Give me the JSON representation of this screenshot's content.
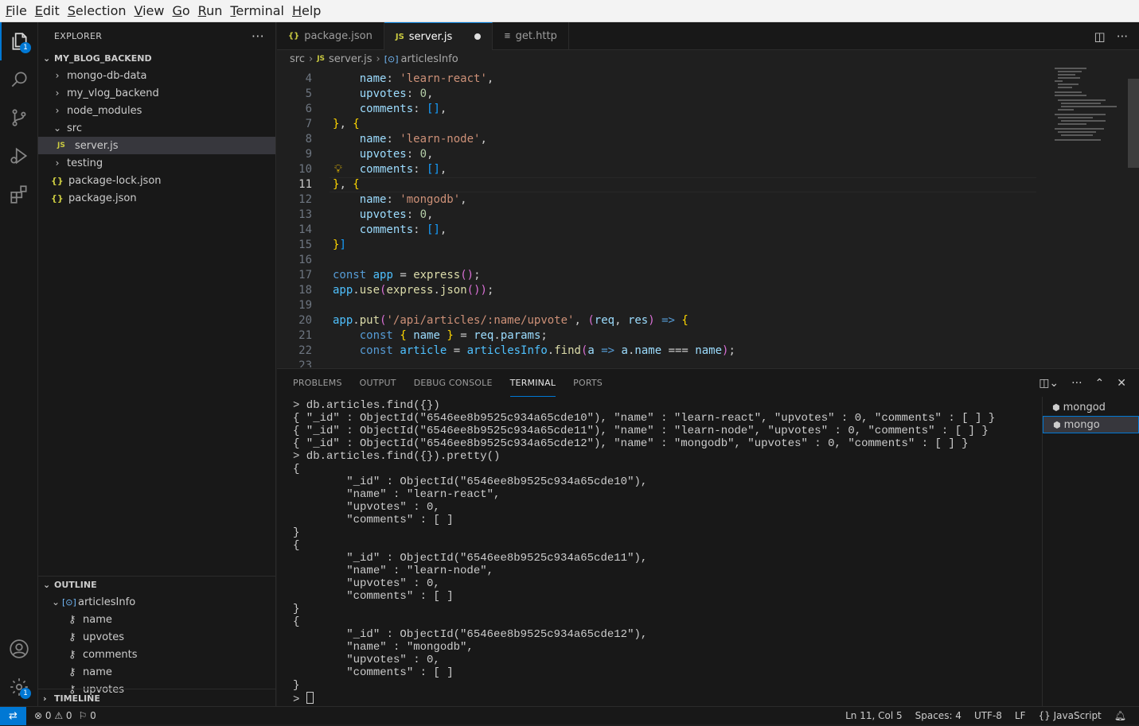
{
  "menu": [
    "File",
    "Edit",
    "Selection",
    "View",
    "Go",
    "Run",
    "Terminal",
    "Help"
  ],
  "menu_mnemonics": [
    "F",
    "E",
    "S",
    "V",
    "G",
    "R",
    "T",
    "H"
  ],
  "activity": {
    "explorer_badge": "1",
    "settings_badge": "1"
  },
  "sidebar": {
    "title": "EXPLORER",
    "project": "MY_BLOG_BACKEND",
    "tree": [
      {
        "label": "mongo-db-data",
        "type": "folder"
      },
      {
        "label": "my_vlog_backend",
        "type": "folder"
      },
      {
        "label": "node_modules",
        "type": "folder"
      },
      {
        "label": "src",
        "type": "folder-open"
      },
      {
        "label": "server.js",
        "type": "js"
      },
      {
        "label": "testing",
        "type": "folder"
      },
      {
        "label": "package-lock.json",
        "type": "json"
      },
      {
        "label": "package.json",
        "type": "json"
      }
    ],
    "outline_title": "OUTLINE",
    "outline": [
      {
        "label": "articlesInfo",
        "kind": "variable"
      },
      {
        "label": "name",
        "kind": "key"
      },
      {
        "label": "upvotes",
        "kind": "key"
      },
      {
        "label": "comments",
        "kind": "key"
      },
      {
        "label": "name",
        "kind": "key"
      },
      {
        "label": "upvotes",
        "kind": "key"
      }
    ],
    "timeline_title": "TIMELINE"
  },
  "tabs": [
    {
      "label": "package.json",
      "icon": "{}"
    },
    {
      "label": "server.js",
      "icon": "JS",
      "active": true,
      "dirty": true
    },
    {
      "label": "get.http",
      "icon": "≡"
    }
  ],
  "breadcrumb": [
    "src",
    "server.js",
    "articlesInfo"
  ],
  "breadcrumb_icons": {
    "js": "JS",
    "symbol": "[⊙]"
  },
  "editor": {
    "current_line": "11",
    "lines": [
      {
        "n": "4",
        "text": "    name: 'learn-react',"
      },
      {
        "n": "5",
        "text": "    upvotes: 0,"
      },
      {
        "n": "6",
        "text": "    comments: [],"
      },
      {
        "n": "7",
        "text": "}, {"
      },
      {
        "n": "8",
        "text": "    name: 'learn-node',"
      },
      {
        "n": "9",
        "text": "    upvotes: 0,"
      },
      {
        "n": "10",
        "text": "    comments: [],"
      },
      {
        "n": "11",
        "text": "}, {"
      },
      {
        "n": "12",
        "text": "    name: 'mongodb',"
      },
      {
        "n": "13",
        "text": "    upvotes: 0,"
      },
      {
        "n": "14",
        "text": "    comments: [],"
      },
      {
        "n": "15",
        "text": "}]"
      },
      {
        "n": "16",
        "text": ""
      },
      {
        "n": "17",
        "text": "const app = express();"
      },
      {
        "n": "18",
        "text": "app.use(express.json());"
      },
      {
        "n": "19",
        "text": ""
      },
      {
        "n": "20",
        "text": "app.put('/api/articles/:name/upvote', (req, res) => {"
      },
      {
        "n": "21",
        "text": "    const { name } = req.params;"
      },
      {
        "n": "22",
        "text": "    const article = articlesInfo.find(a => a.name === name);"
      },
      {
        "n": "23",
        "text": ""
      }
    ]
  },
  "panel": {
    "tabs": [
      "PROBLEMS",
      "OUTPUT",
      "DEBUG CONSOLE",
      "TERMINAL",
      "PORTS"
    ],
    "active_tab": "TERMINAL",
    "terminal_lines": [
      "> db.articles.find({})",
      "{ \"_id\" : ObjectId(\"6546ee8b9525c934a65cde10\"), \"name\" : \"learn-react\", \"upvotes\" : 0, \"comments\" : [ ] }",
      "{ \"_id\" : ObjectId(\"6546ee8b9525c934a65cde11\"), \"name\" : \"learn-node\", \"upvotes\" : 0, \"comments\" : [ ] }",
      "{ \"_id\" : ObjectId(\"6546ee8b9525c934a65cde12\"), \"name\" : \"mongodb\", \"upvotes\" : 0, \"comments\" : [ ] }",
      "> db.articles.find({}).pretty()",
      "{",
      "        \"_id\" : ObjectId(\"6546ee8b9525c934a65cde10\"),",
      "        \"name\" : \"learn-react\",",
      "        \"upvotes\" : 0,",
      "        \"comments\" : [ ]",
      "}",
      "{",
      "        \"_id\" : ObjectId(\"6546ee8b9525c934a65cde11\"),",
      "        \"name\" : \"learn-node\",",
      "        \"upvotes\" : 0,",
      "        \"comments\" : [ ]",
      "}",
      "{",
      "        \"_id\" : ObjectId(\"6546ee8b9525c934a65cde12\"),",
      "        \"name\" : \"mongodb\",",
      "        \"upvotes\" : 0,",
      "        \"comments\" : [ ]",
      "}",
      "> "
    ],
    "terminals": [
      {
        "label": "mongod",
        "selected": false
      },
      {
        "label": "mongo",
        "selected": true
      }
    ]
  },
  "status": {
    "errors": "0",
    "warnings": "0",
    "ports": "0",
    "position": "Ln 11, Col 5",
    "spaces": "Spaces: 4",
    "encoding": "UTF-8",
    "eol": "LF",
    "language": "JavaScript"
  },
  "colors": {
    "accent": "#0078d4",
    "editor_bg": "#1f1f1f",
    "sidebar_bg": "#181818",
    "menubar_bg": "#f3f3f3"
  }
}
